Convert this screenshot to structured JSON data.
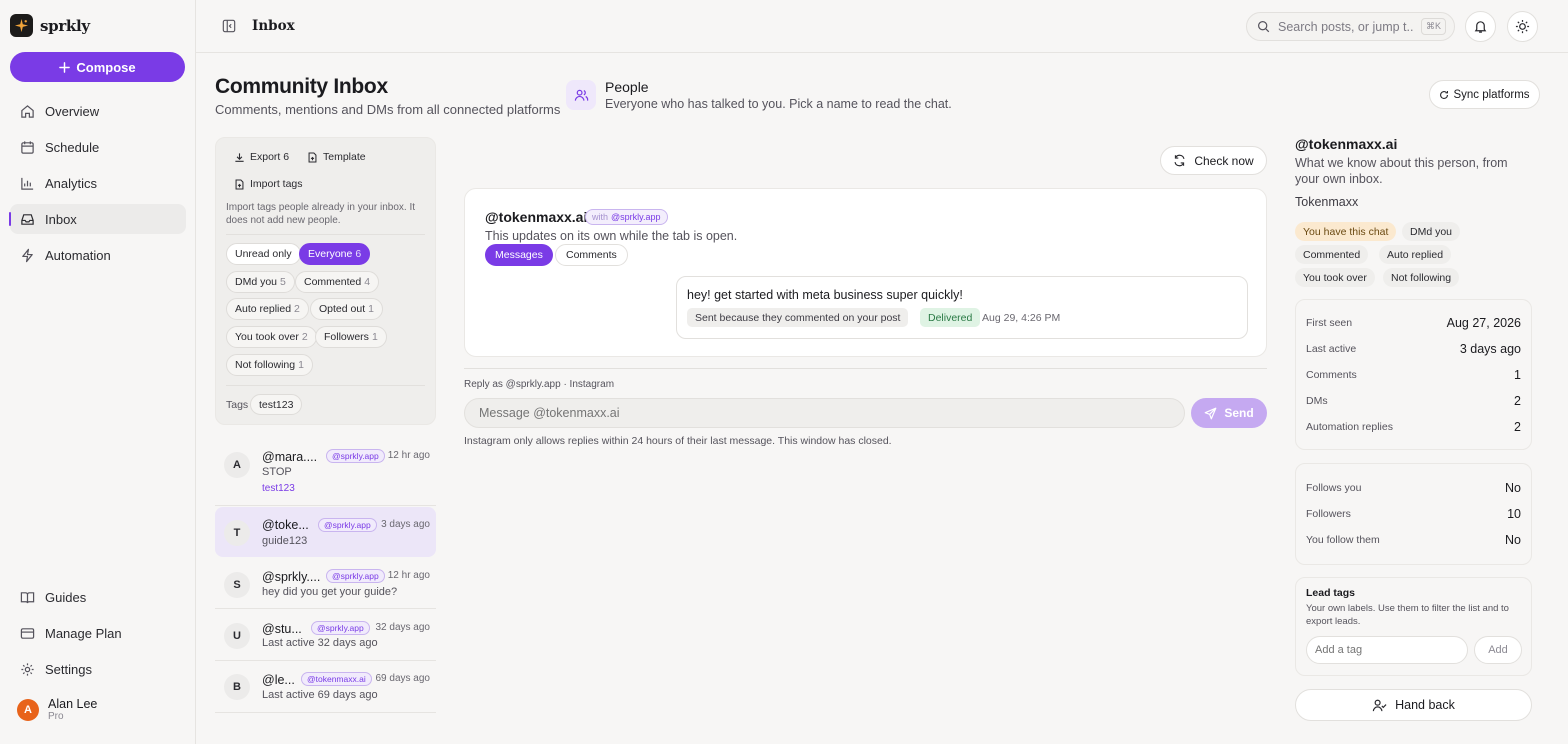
{
  "app": {
    "name": "sprkly",
    "compose_label": "Compose"
  },
  "nav": {
    "items": [
      {
        "label": "Overview",
        "icon": "home-icon"
      },
      {
        "label": "Schedule",
        "icon": "calendar-icon"
      },
      {
        "label": "Analytics",
        "icon": "chart-icon"
      },
      {
        "label": "Inbox",
        "icon": "inbox-icon"
      },
      {
        "label": "Automation",
        "icon": "bolt-icon"
      }
    ],
    "bottom": [
      {
        "label": "Guides",
        "icon": "book-icon"
      },
      {
        "label": "Manage Plan",
        "icon": "card-icon"
      },
      {
        "label": "Settings",
        "icon": "gear-icon"
      }
    ]
  },
  "user": {
    "initial": "A",
    "name": "Alan Lee",
    "plan": "Pro"
  },
  "topbar": {
    "title": "Inbox",
    "search_placeholder": "Search posts, or jump t...",
    "shortcut": "⌘K"
  },
  "page": {
    "title": "Community Inbox",
    "subtitle": "Comments, mentions and DMs from all connected platforms"
  },
  "people": {
    "title": "People",
    "subtitle": "Everyone who has talked to you. Pick a name to read the chat."
  },
  "sync_label": "Sync platforms",
  "filters": {
    "export_label": "Export 6",
    "template_label": "Template",
    "import_label": "Import tags",
    "note": "Import tags people already in your inbox. It does not add new people.",
    "chips": [
      {
        "label": "Unread only",
        "count": ""
      },
      {
        "label": "Everyone",
        "count": "6"
      },
      {
        "label": "DMd you",
        "count": "5"
      },
      {
        "label": "Commented",
        "count": "4"
      },
      {
        "label": "Auto replied",
        "count": "2"
      },
      {
        "label": "Opted out",
        "count": "1"
      },
      {
        "label": "You took over",
        "count": "2"
      },
      {
        "label": "Followers",
        "count": "1"
      },
      {
        "label": "Not following",
        "count": "1"
      }
    ],
    "tags_label": "Tags",
    "tags": [
      "test123"
    ]
  },
  "conversations": [
    {
      "initial": "A",
      "name": "@mara....",
      "account": "@sprkly.app",
      "time": "12 hr ago",
      "preview": "STOP",
      "tag": "test123"
    },
    {
      "initial": "T",
      "name": "@toke...",
      "account": "@sprkly.app",
      "time": "3 days ago",
      "preview": "guide123",
      "tag": ""
    },
    {
      "initial": "S",
      "name": "@sprkly....",
      "account": "@sprkly.app",
      "time": "12 hr ago",
      "preview": "hey did you get your guide?",
      "tag": ""
    },
    {
      "initial": "U",
      "name": "@stu...",
      "account": "@sprkly.app",
      "time": "32 days ago",
      "preview": "Last active 32 days ago",
      "tag": ""
    },
    {
      "initial": "B",
      "name": "@le...",
      "account": "@tokenmaxx.ai",
      "time": "69 days ago",
      "preview": "Last active 69 days ago",
      "tag": ""
    }
  ],
  "chat": {
    "check_label": "Check now",
    "handle": "@tokenmaxx.ai",
    "with_word": "with",
    "with_account": "@sprkly.app",
    "subtitle": "This updates on its own while the tab is open.",
    "tab_messages": "Messages",
    "tab_comments": "Comments",
    "message": {
      "text": "hey! get started with meta business super quickly!",
      "reason": "Sent because they commented on your post",
      "status": "Delivered",
      "timestamp": "Aug 29, 4:26 PM"
    },
    "reply_as": "Reply as @sprkly.app · Instagram",
    "input_placeholder": "Message @tokenmaxx.ai",
    "send_label": "Send",
    "window_note": "Instagram only allows replies within 24 hours of their last message. This window has closed."
  },
  "profile": {
    "handle": "@tokenmaxx.ai",
    "subtitle": "What we know about this person, from your own inbox.",
    "name": "Tokenmaxx",
    "chips": [
      "You have this chat",
      "DMd you",
      "Commented",
      "Auto replied",
      "You took over",
      "Not following"
    ],
    "stats": [
      {
        "k": "First seen",
        "v": "Aug 27, 2026"
      },
      {
        "k": "Last active",
        "v": "3 days ago"
      },
      {
        "k": "Comments",
        "v": "1"
      },
      {
        "k": "DMs",
        "v": "2"
      },
      {
        "k": "Automation replies",
        "v": "2"
      }
    ],
    "follow": [
      {
        "k": "Follows you",
        "v": "No"
      },
      {
        "k": "Followers",
        "v": "10"
      },
      {
        "k": "You follow them",
        "v": "No"
      }
    ],
    "lead_tags_title": "Lead tags",
    "lead_tags_sub": "Your own labels. Use them to filter the list and to export leads.",
    "tag_placeholder": "Add a tag",
    "add_label": "Add",
    "handback_label": "Hand back"
  },
  "colors": {
    "accent": "#7a3be6",
    "delivered_bg": "#dff3e4",
    "highlight_chip": "#fbe9cf",
    "avatar": "#e8631a"
  }
}
